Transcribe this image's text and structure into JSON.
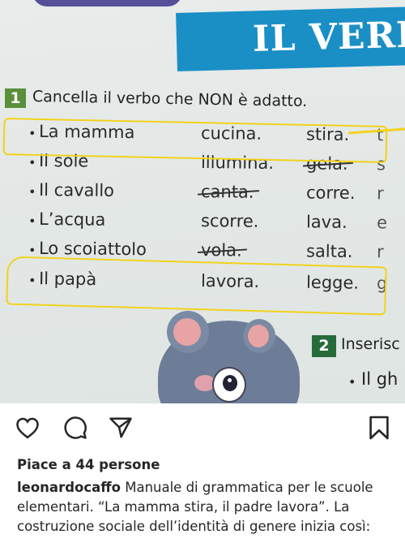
{
  "book": {
    "title": "IL VERB",
    "exercise1": {
      "number": "1",
      "instruction": "Cancella il verbo che NON è adatto.",
      "rows": [
        {
          "subject": "La mamma",
          "verb1": "cucina.",
          "verb2": "stira.",
          "cut": "t"
        },
        {
          "subject": "Il sole",
          "verb1": "illumina.",
          "verb2": "gela.",
          "cut": "s"
        },
        {
          "subject": "Il cavallo",
          "verb1": "canta.",
          "verb2": "corre.",
          "cut": "r"
        },
        {
          "subject": "L’acqua",
          "verb1": "scorre.",
          "verb2": "lava.",
          "cut": "e"
        },
        {
          "subject": "Lo scoiattolo",
          "verb1": "vola.",
          "verb2": "salta.",
          "cut": "r"
        },
        {
          "subject": "Il papà",
          "verb1": "lavora.",
          "verb2": "legge.",
          "cut": "g"
        }
      ]
    },
    "exercise2": {
      "number": "2",
      "instruction": "Inserisc",
      "item": "Il gh"
    }
  },
  "post": {
    "likes": "Piace a 44 persone",
    "username": "leonardocaffo",
    "caption": "Manuale di grammatica per le scuole elementari. “La mamma stira, il padre lavora”. La costruzione sociale dell’identità di genere inizia così:"
  },
  "icons": [
    "heart-icon",
    "comment-icon",
    "share-icon",
    "bookmark-icon"
  ],
  "colors": {
    "title_band": "#1a8fc6",
    "highlight": "#f2d21c",
    "exercise_badge": "#5a8f3b"
  }
}
